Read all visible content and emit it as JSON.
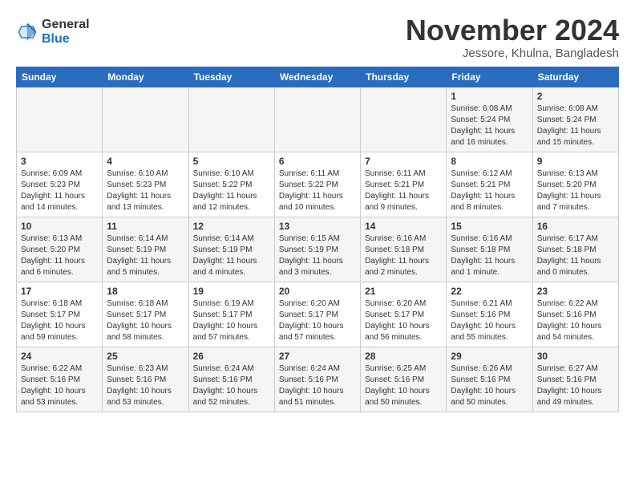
{
  "logo": {
    "line1": "General",
    "line2": "Blue"
  },
  "title": "November 2024",
  "location": "Jessore, Khulna, Bangladesh",
  "weekdays": [
    "Sunday",
    "Monday",
    "Tuesday",
    "Wednesday",
    "Thursday",
    "Friday",
    "Saturday"
  ],
  "weeks": [
    [
      {
        "day": "",
        "info": ""
      },
      {
        "day": "",
        "info": ""
      },
      {
        "day": "",
        "info": ""
      },
      {
        "day": "",
        "info": ""
      },
      {
        "day": "",
        "info": ""
      },
      {
        "day": "1",
        "info": "Sunrise: 6:08 AM\nSunset: 5:24 PM\nDaylight: 11 hours\nand 16 minutes."
      },
      {
        "day": "2",
        "info": "Sunrise: 6:08 AM\nSunset: 5:24 PM\nDaylight: 11 hours\nand 15 minutes."
      }
    ],
    [
      {
        "day": "3",
        "info": "Sunrise: 6:09 AM\nSunset: 5:23 PM\nDaylight: 11 hours\nand 14 minutes."
      },
      {
        "day": "4",
        "info": "Sunrise: 6:10 AM\nSunset: 5:23 PM\nDaylight: 11 hours\nand 13 minutes."
      },
      {
        "day": "5",
        "info": "Sunrise: 6:10 AM\nSunset: 5:22 PM\nDaylight: 11 hours\nand 12 minutes."
      },
      {
        "day": "6",
        "info": "Sunrise: 6:11 AM\nSunset: 5:22 PM\nDaylight: 11 hours\nand 10 minutes."
      },
      {
        "day": "7",
        "info": "Sunrise: 6:11 AM\nSunset: 5:21 PM\nDaylight: 11 hours\nand 9 minutes."
      },
      {
        "day": "8",
        "info": "Sunrise: 6:12 AM\nSunset: 5:21 PM\nDaylight: 11 hours\nand 8 minutes."
      },
      {
        "day": "9",
        "info": "Sunrise: 6:13 AM\nSunset: 5:20 PM\nDaylight: 11 hours\nand 7 minutes."
      }
    ],
    [
      {
        "day": "10",
        "info": "Sunrise: 6:13 AM\nSunset: 5:20 PM\nDaylight: 11 hours\nand 6 minutes."
      },
      {
        "day": "11",
        "info": "Sunrise: 6:14 AM\nSunset: 5:19 PM\nDaylight: 11 hours\nand 5 minutes."
      },
      {
        "day": "12",
        "info": "Sunrise: 6:14 AM\nSunset: 5:19 PM\nDaylight: 11 hours\nand 4 minutes."
      },
      {
        "day": "13",
        "info": "Sunrise: 6:15 AM\nSunset: 5:19 PM\nDaylight: 11 hours\nand 3 minutes."
      },
      {
        "day": "14",
        "info": "Sunrise: 6:16 AM\nSunset: 5:18 PM\nDaylight: 11 hours\nand 2 minutes."
      },
      {
        "day": "15",
        "info": "Sunrise: 6:16 AM\nSunset: 5:18 PM\nDaylight: 11 hours\nand 1 minute."
      },
      {
        "day": "16",
        "info": "Sunrise: 6:17 AM\nSunset: 5:18 PM\nDaylight: 11 hours\nand 0 minutes."
      }
    ],
    [
      {
        "day": "17",
        "info": "Sunrise: 6:18 AM\nSunset: 5:17 PM\nDaylight: 10 hours\nand 59 minutes."
      },
      {
        "day": "18",
        "info": "Sunrise: 6:18 AM\nSunset: 5:17 PM\nDaylight: 10 hours\nand 58 minutes."
      },
      {
        "day": "19",
        "info": "Sunrise: 6:19 AM\nSunset: 5:17 PM\nDaylight: 10 hours\nand 57 minutes."
      },
      {
        "day": "20",
        "info": "Sunrise: 6:20 AM\nSunset: 5:17 PM\nDaylight: 10 hours\nand 57 minutes."
      },
      {
        "day": "21",
        "info": "Sunrise: 6:20 AM\nSunset: 5:17 PM\nDaylight: 10 hours\nand 56 minutes."
      },
      {
        "day": "22",
        "info": "Sunrise: 6:21 AM\nSunset: 5:16 PM\nDaylight: 10 hours\nand 55 minutes."
      },
      {
        "day": "23",
        "info": "Sunrise: 6:22 AM\nSunset: 5:16 PM\nDaylight: 10 hours\nand 54 minutes."
      }
    ],
    [
      {
        "day": "24",
        "info": "Sunrise: 6:22 AM\nSunset: 5:16 PM\nDaylight: 10 hours\nand 53 minutes."
      },
      {
        "day": "25",
        "info": "Sunrise: 6:23 AM\nSunset: 5:16 PM\nDaylight: 10 hours\nand 53 minutes."
      },
      {
        "day": "26",
        "info": "Sunrise: 6:24 AM\nSunset: 5:16 PM\nDaylight: 10 hours\nand 52 minutes."
      },
      {
        "day": "27",
        "info": "Sunrise: 6:24 AM\nSunset: 5:16 PM\nDaylight: 10 hours\nand 51 minutes."
      },
      {
        "day": "28",
        "info": "Sunrise: 6:25 AM\nSunset: 5:16 PM\nDaylight: 10 hours\nand 50 minutes."
      },
      {
        "day": "29",
        "info": "Sunrise: 6:26 AM\nSunset: 5:16 PM\nDaylight: 10 hours\nand 50 minutes."
      },
      {
        "day": "30",
        "info": "Sunrise: 6:27 AM\nSunset: 5:16 PM\nDaylight: 10 hours\nand 49 minutes."
      }
    ]
  ]
}
